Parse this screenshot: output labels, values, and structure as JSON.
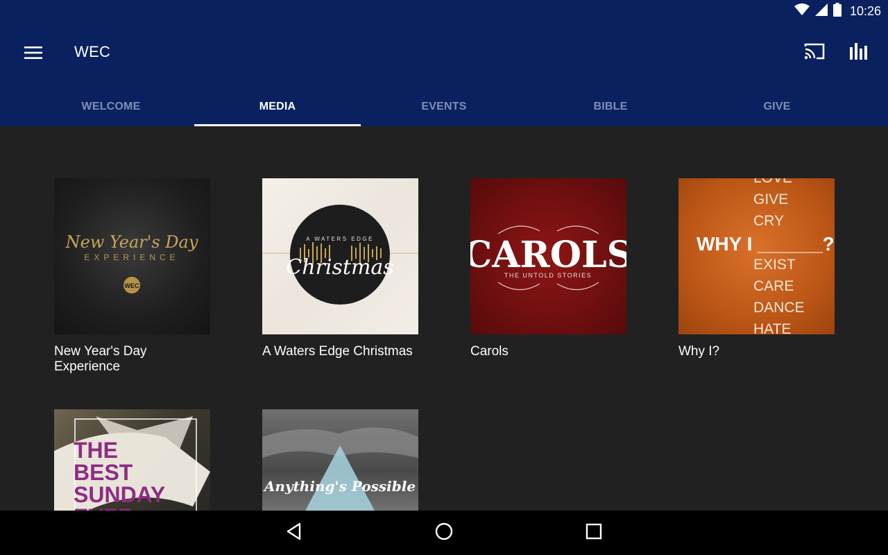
{
  "status_bar": {
    "time": "10:26",
    "icons": [
      "wifi-icon",
      "cell-signal-icon",
      "battery-icon"
    ]
  },
  "app_bar": {
    "title": "WEC",
    "left_icon": "hamburger-menu-icon",
    "right_icons": [
      "cast-icon",
      "bar-chart-icon"
    ],
    "background": "#0a2160"
  },
  "tabs": [
    {
      "label": "WELCOME",
      "active": false
    },
    {
      "label": "MEDIA",
      "active": true
    },
    {
      "label": "EVENTS",
      "active": false
    },
    {
      "label": "BIBLE",
      "active": false
    },
    {
      "label": "GIVE",
      "active": false
    }
  ],
  "media": [
    {
      "title": "New Year's Day Experience",
      "art": {
        "script": "New Year's Day",
        "sub": "EXPERIENCE",
        "badge": "WEC"
      }
    },
    {
      "title": "A Waters Edge Christmas",
      "art": {
        "top": "A WATERS EDGE",
        "script": "Christmas"
      }
    },
    {
      "title": "Carols",
      "art": {
        "word": "CAROLS",
        "sub": "THE UNTOLD STORIES"
      }
    },
    {
      "title": "Why I?",
      "art": {
        "headline": "WHY I ______?",
        "words": [
          "LOVE",
          "GIVE",
          "CRY",
          "EXIST",
          "CARE",
          "DANCE",
          "HATE"
        ]
      }
    },
    {
      "title": "",
      "art": {
        "lines": [
          "THE",
          "BEST",
          "SUNDAY",
          "EVER"
        ]
      }
    },
    {
      "title": "",
      "art": {
        "script": "Anything's Possible"
      }
    }
  ],
  "nav_bar": {
    "icons": [
      "back-icon",
      "home-icon",
      "recents-icon"
    ]
  }
}
